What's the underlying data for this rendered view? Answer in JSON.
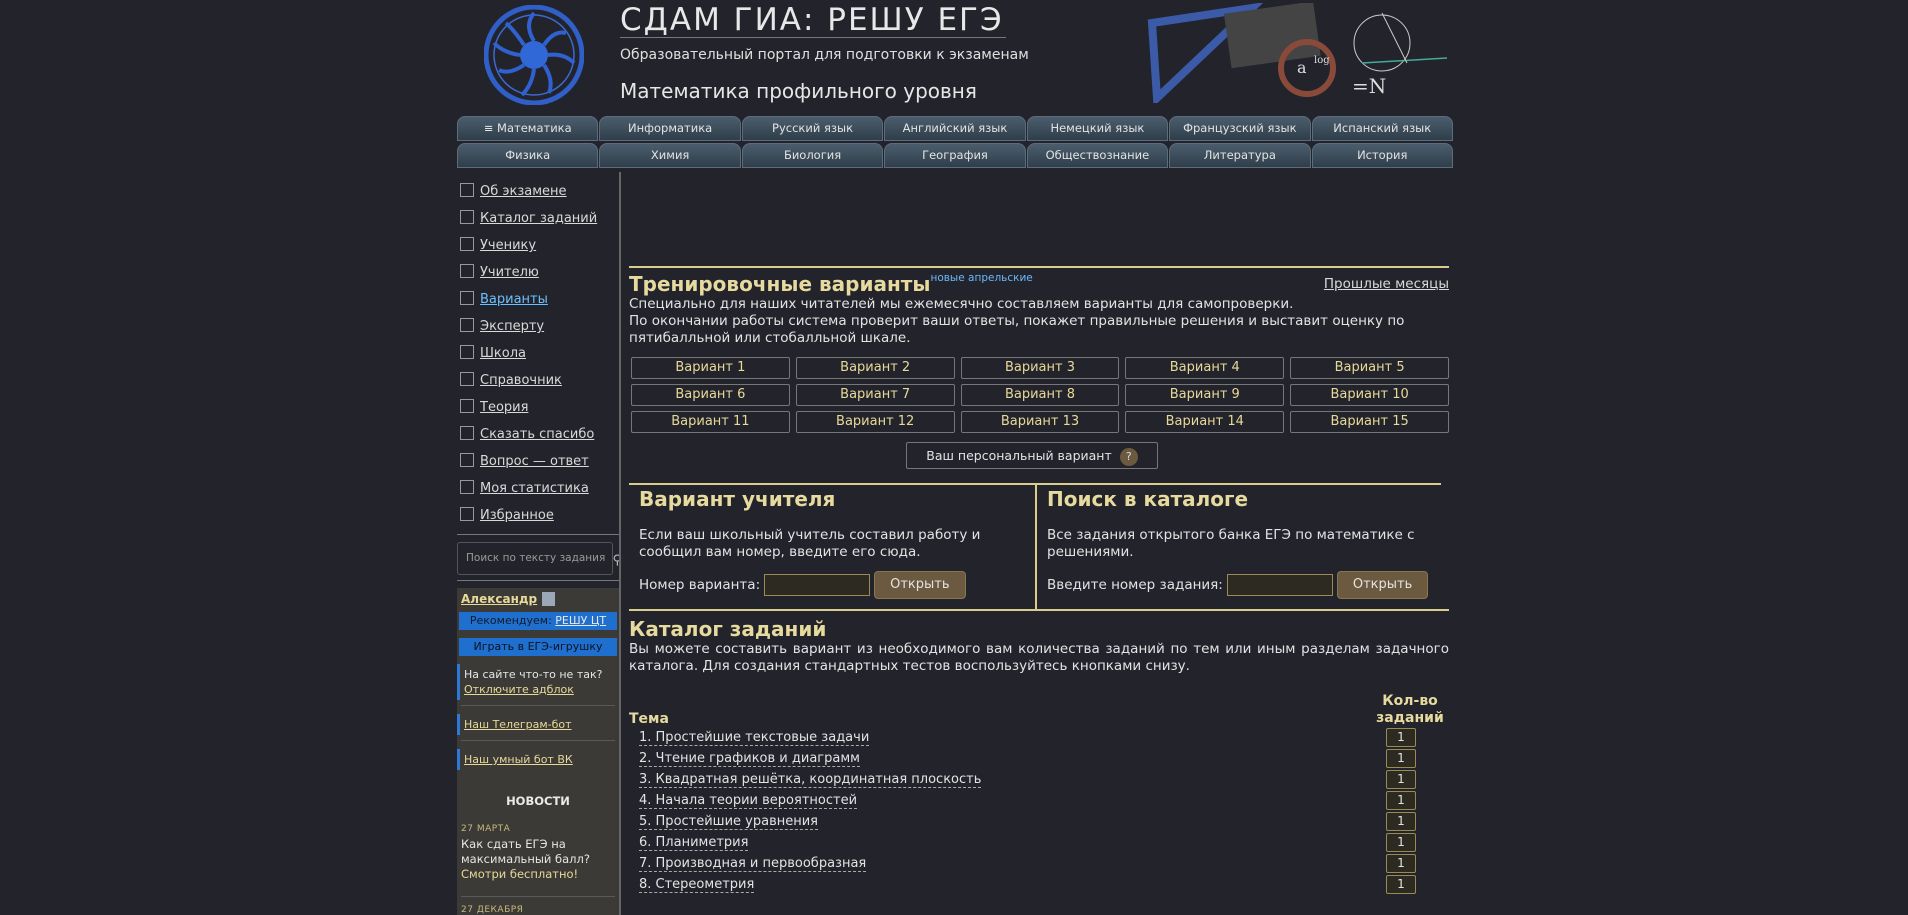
{
  "header": {
    "title": "СДАМ ГИА: РЕШУ ЕГЭ",
    "subtitle": "Образовательный портал для подготовки к экзаменам",
    "subject": "Математика профильного уровня"
  },
  "subjects_row1": [
    "≡ Математика",
    "Информатика",
    "Русский язык",
    "Английский язык",
    "Немецкий язык",
    "Французский язык",
    "Испанский язык"
  ],
  "subjects_row2": [
    "Физика",
    "Химия",
    "Биология",
    "География",
    "Обществознание",
    "Литература",
    "История"
  ],
  "sidebar": {
    "menu": [
      "Об экзамене",
      "Каталог заданий",
      "Ученику",
      "Учителю",
      "Варианты",
      "Эксперту",
      "Школа",
      "Справочник",
      "Теория",
      "Сказать спасибо",
      "Вопрос — ответ",
      "Моя статистика",
      "Избранное"
    ],
    "active_index": 4,
    "search_placeholder": "Поиск по тексту задания",
    "user": "Александр",
    "recommend_prefix": "Рекомендуем:",
    "recommend_link": "РЕШУ ЦТ",
    "play_button": "Играть в ЕГЭ-игрушку",
    "notice_text": "На сайте что-то не так?",
    "notice_link": "Отключите адблок",
    "telegram": "Наш Телеграм-бот",
    "vk": "Наш умный бот ВК",
    "news_heading": "НОВОСТИ",
    "news1_date": "27 МАРТА",
    "news1_text": "Как сдать ЕГЭ на максимальный балл?",
    "news1_link": "Смотри бесплатно!",
    "news2_date": "27 ДЕКАБРЯ"
  },
  "training": {
    "title": "Тренировочные варианты",
    "new_tag": "новые апрельские",
    "past_link": "Прошлые месяцы",
    "desc1": "Специально для наших читателей мы ежемесячно составляем варианты для самопроверки.",
    "desc2": "По окончании работы система проверит ваши ответы, покажет правильные решения и выставит оценку по пятибалльной или стобалльной шкале.",
    "variants": [
      "Вариант 1",
      "Вариант 2",
      "Вариант 3",
      "Вариант 4",
      "Вариант 5",
      "Вариант 6",
      "Вариант 7",
      "Вариант 8",
      "Вариант 9",
      "Вариант 10",
      "Вариант 11",
      "Вариант 12",
      "Вариант 13",
      "Вариант 14",
      "Вариант 15"
    ],
    "personal": "Ваш персональный вариант",
    "personal_help": "?"
  },
  "teacher": {
    "title": "Вариант учителя",
    "text": "Если ваш школьный учитель составил работу и сообщил вам номер, введите его сюда.",
    "label": "Номер варианта:",
    "button": "Открыть"
  },
  "catalog_search": {
    "title": "Поиск в каталоге",
    "text": "Все задания открытого банка ЕГЭ по математике с решениями.",
    "label": "Введите номер задания:",
    "button": "Открыть"
  },
  "catalog": {
    "title": "Каталог заданий",
    "text": "Вы можете составить вариант из необходимого вам количества заданий по тем или иным разделам задачного каталога. Для создания стандартных тестов воспользуйтесь кнопками снизу.",
    "col_topic": "Тема",
    "col_count": "Кол-во заданий",
    "topics": [
      {
        "name": "1. Простейшие текстовые задачи",
        "count": "1"
      },
      {
        "name": "2. Чтение графиков и диаграмм",
        "count": "1"
      },
      {
        "name": "3. Квадратная решётка, координатная плоскость",
        "count": "1"
      },
      {
        "name": "4. Начала теории вероятностей",
        "count": "1"
      },
      {
        "name": "5. Простейшие уравнения",
        "count": "1"
      },
      {
        "name": "6. Планиметрия",
        "count": "1"
      },
      {
        "name": "7. Производная и первообразная",
        "count": "1"
      },
      {
        "name": "8. Стереометрия",
        "count": "1"
      }
    ]
  },
  "colors": {
    "accent": "#e7da9e",
    "link_active": "#6ac0ff",
    "background": "#23242b",
    "blue": "#1f6fcf"
  }
}
